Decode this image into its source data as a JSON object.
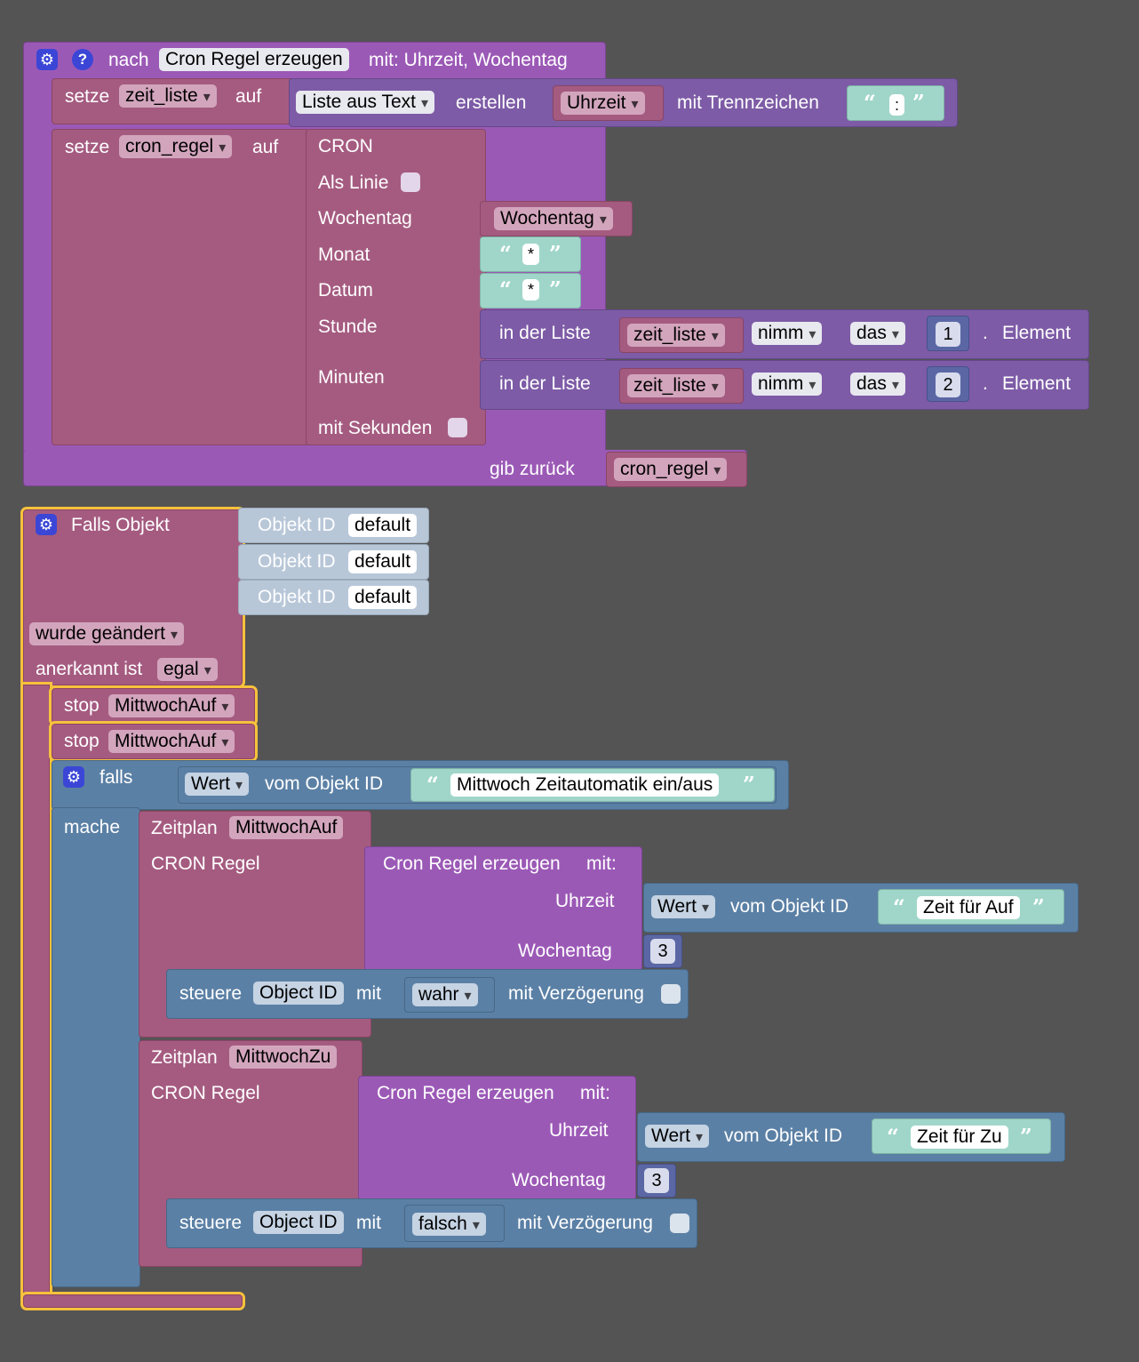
{
  "func": {
    "nach": "nach",
    "name": "Cron Regel erzeugen",
    "params": "mit: Uhrzeit, Wochentag",
    "help": "?",
    "setze1": "setze",
    "var1": "zeit_liste",
    "auf1": "auf",
    "list_mode": "Liste aus Text",
    "erstellen": "erstellen",
    "uhrzeit_var": "Uhrzeit",
    "mit_trenn": "mit Trennzeichen",
    "sep": ":",
    "setze2": "setze",
    "var2": "cron_regel",
    "auf2": "auf",
    "cron": "CRON",
    "als_linie": "Als Linie",
    "wochentag_label": "Wochentag",
    "wochentag_var": "Wochentag",
    "monat": "Monat",
    "monat_val": "*",
    "datum": "Datum",
    "datum_val": "*",
    "stunde": "Stunde",
    "minuten": "Minuten",
    "in_der_liste": "in der Liste",
    "nimm": "nimm",
    "das": "das",
    "idx1": "1",
    "idx2": "2",
    "dot": ".",
    "element": "Element",
    "mit_sekunden": "mit Sekunden",
    "gib_zurueck": "gib zurück",
    "ret_var": "cron_regel"
  },
  "trigger": {
    "falls_objekt": "Falls Objekt",
    "objekt_id": "Objekt ID",
    "default": "default",
    "wurde_geaendert": "wurde geändert",
    "anerkannt_ist": "anerkannt ist",
    "egal": "egal",
    "stop": "stop",
    "schedule1": "MittwochAuf",
    "schedule2": "MittwochAuf",
    "falls": "falls",
    "wert": "Wert",
    "vom_objekt_id": "vom Objekt ID",
    "cond_text": "Mittwoch Zeitautomatik ein/aus",
    "mache": "mache",
    "zeitplan": "Zeitplan",
    "zp1_name": "MittwochAuf",
    "cron_regel": "CRON Regel",
    "cron_erzeugen": "Cron Regel erzeugen",
    "mit": "mit:",
    "uhrzeit": "Uhrzeit",
    "zeit_auf": "Zeit für Auf",
    "wochentag": "Wochentag",
    "wt_val1": "3",
    "steuere": "steuere",
    "object_id": "Object ID",
    "mit_plain": "mit",
    "wahr": "wahr",
    "mit_verz": "mit Verzögerung",
    "zp2_name": "MittwochZu",
    "zeit_zu": "Zeit für Zu",
    "wt_val2": "3",
    "falsch": "falsch"
  }
}
